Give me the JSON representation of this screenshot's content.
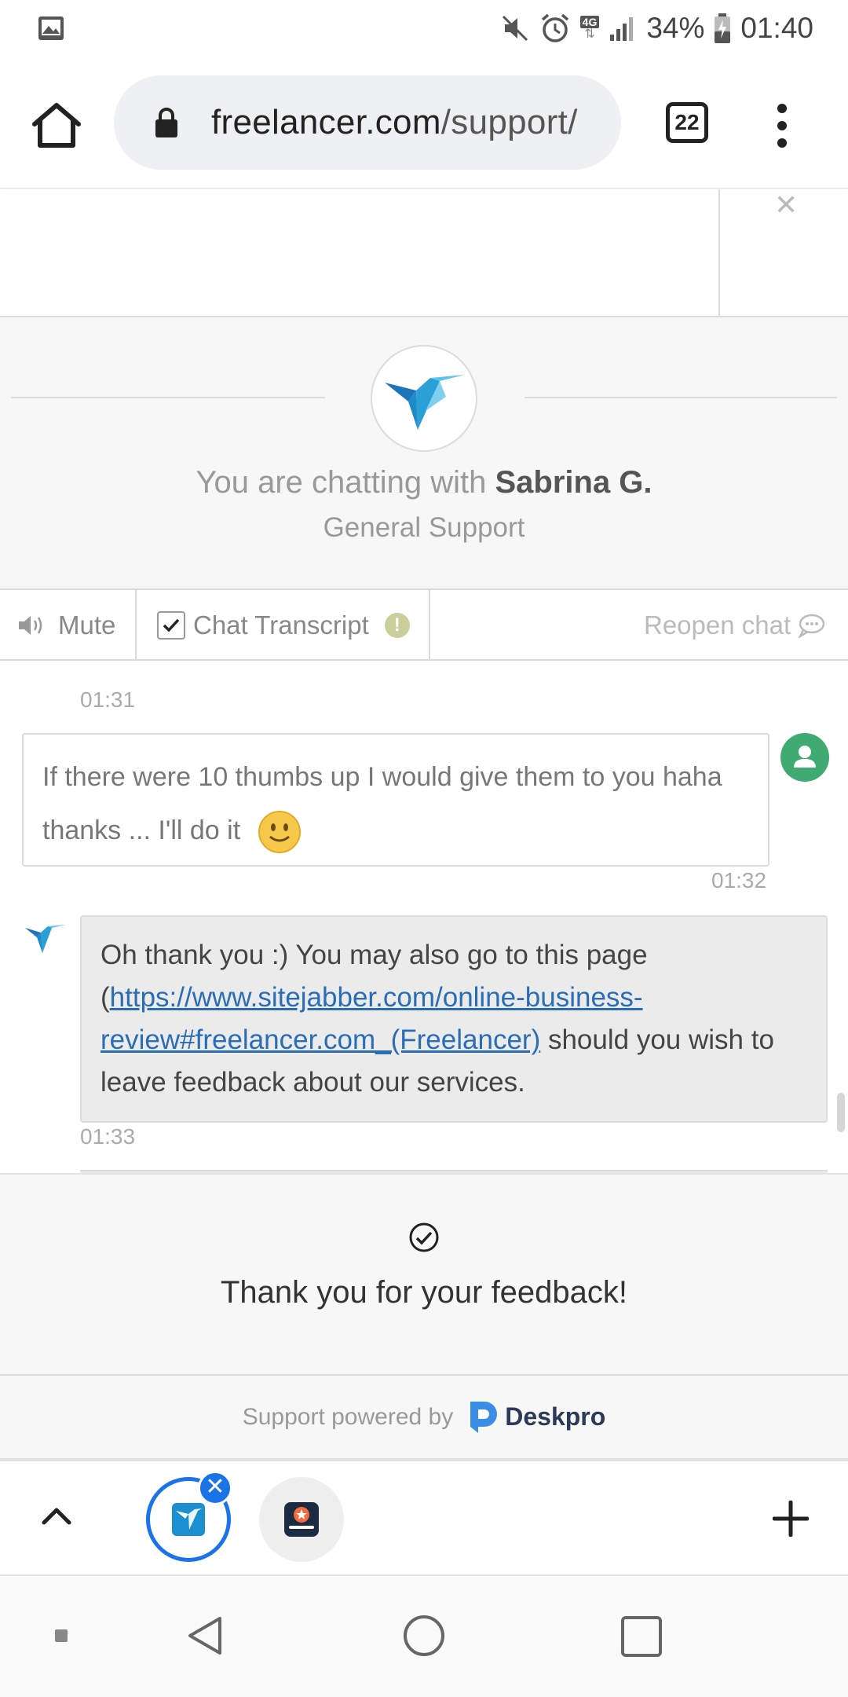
{
  "status_bar": {
    "network": "4G",
    "battery": "34%",
    "time": "01:40"
  },
  "browser": {
    "url_domain": "freelancer.com",
    "url_path": "/support/",
    "tab_count": "22"
  },
  "chat_header": {
    "intro": "You are chatting with ",
    "agent_name": "Sabrina G.",
    "department": "General Support"
  },
  "toolbar": {
    "mute_label": "Mute",
    "transcript_label": "Chat Transcript",
    "reopen_label": "Reopen chat"
  },
  "messages": [
    {
      "sender": "user",
      "time_above": "01:31",
      "text": "If there were 10 thumbs up I would give them to you haha thanks ... I'll do it",
      "time": "01:32"
    },
    {
      "sender": "agent",
      "text_before": "Oh thank you :) You may also go to this page (",
      "link": "https://www.sitejabber.com/online-business-review#freelancer.com_(Freelancer)",
      "text_after": " should you wish to leave feedback about our services.",
      "time": "01:33"
    }
  ],
  "feedback": {
    "message": "Thank you for your feedback!"
  },
  "powered": {
    "label": "Support powered by",
    "brand": "Deskpro"
  },
  "tab_strip": {
    "tabs": [
      "freelancer",
      "sitejabber"
    ]
  },
  "colors": {
    "accent_blue": "#1a73e8",
    "link": "#2a6db5",
    "user_avatar": "#3fab72",
    "freelancer_blue": "#29a1d8"
  }
}
